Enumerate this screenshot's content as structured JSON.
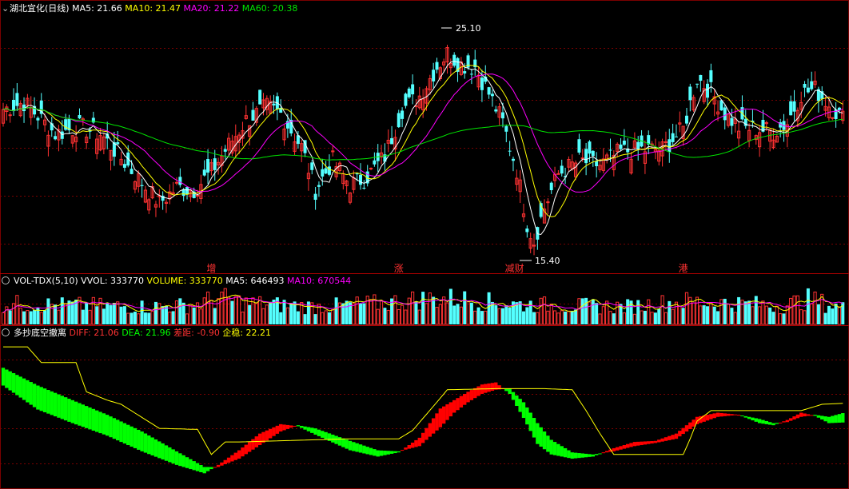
{
  "colors": {
    "background": "#000000",
    "up": "#ff3232",
    "down": "#54ffff",
    "ma5": "#ffffff",
    "ma10": "#ffff00",
    "ma20": "#ff00ff",
    "ma60": "#00e600",
    "grid": "#7a0000",
    "diff_green": "#00ff00",
    "diff_red": "#ff0000",
    "stabilize": "#ffff00"
  },
  "price_panel": {
    "icon": "chevron-down-icon",
    "title": "湖北宜化(日线)",
    "legend": [
      {
        "text": "MA5: 21.66",
        "color": "#ffffff"
      },
      {
        "text": "MA10: 21.47",
        "color": "#ffff00"
      },
      {
        "text": "MA20: 21.22",
        "color": "#ff00ff"
      },
      {
        "text": "MA60: 20.38",
        "color": "#00e600"
      }
    ],
    "high_label": "25.10",
    "low_label": "15.40",
    "markers": [
      {
        "text": "增",
        "index": 60
      },
      {
        "text": "涨",
        "index": 114
      },
      {
        "text": "减财",
        "index": 146
      },
      {
        "text": "港",
        "index": 196
      }
    ]
  },
  "volume_panel": {
    "icon": "chevron-down-icon",
    "legend": [
      {
        "text": "VOL-TDX(5,10)",
        "color": "#ffffff"
      },
      {
        "text": "VVOL: 333770",
        "color": "#ffffff"
      },
      {
        "text": "VOLUME: 333770",
        "color": "#ffff00"
      },
      {
        "text": "MA5: 646493",
        "color": "#ffffff"
      },
      {
        "text": "MA10: 670544",
        "color": "#ff00ff"
      }
    ]
  },
  "indicator_panel": {
    "icon": "chevron-down-icon",
    "legend": [
      {
        "text": "多抄底空撤离",
        "color": "#ffffff"
      },
      {
        "text": "DIFF: 21.06",
        "color": "#ff3232"
      },
      {
        "text": "DEA: 21.96",
        "color": "#00ff00"
      },
      {
        "text": "差距: -0.90",
        "color": "#ff3232"
      },
      {
        "text": "企稳: 22.21",
        "color": "#ffff00"
      }
    ]
  },
  "chart_data": {
    "type": "candlestick",
    "price_range": [
      15.0,
      26.0
    ],
    "series_names": [
      "MA5",
      "MA10",
      "MA20",
      "MA60"
    ],
    "price_keypoints": [
      [
        0,
        21.9
      ],
      [
        6,
        22.2
      ],
      [
        10,
        21.6
      ],
      [
        15,
        20.8
      ],
      [
        22,
        21.1
      ],
      [
        28,
        20.8
      ],
      [
        33,
        19.9
      ],
      [
        40,
        18.6
      ],
      [
        45,
        17.7
      ],
      [
        50,
        18.4
      ],
      [
        55,
        18.3
      ],
      [
        60,
        19.1
      ],
      [
        65,
        20.3
      ],
      [
        70,
        21.4
      ],
      [
        76,
        22.0
      ],
      [
        80,
        21.7
      ],
      [
        86,
        20.2
      ],
      [
        90,
        18.3
      ],
      [
        95,
        19.6
      ],
      [
        100,
        18.5
      ],
      [
        105,
        18.9
      ],
      [
        110,
        19.8
      ],
      [
        115,
        21.9
      ],
      [
        120,
        22.5
      ],
      [
        125,
        23.8
      ],
      [
        128,
        24.4
      ],
      [
        132,
        23.9
      ],
      [
        136,
        23.8
      ],
      [
        140,
        22.6
      ],
      [
        144,
        21.3
      ],
      [
        148,
        19.2
      ],
      [
        151,
        16.8
      ],
      [
        153,
        16.0
      ],
      [
        156,
        17.5
      ],
      [
        160,
        19.0
      ],
      [
        166,
        19.6
      ],
      [
        172,
        19.4
      ],
      [
        178,
        20.0
      ],
      [
        184,
        20.1
      ],
      [
        190,
        20.1
      ],
      [
        196,
        21.0
      ],
      [
        200,
        23.3
      ],
      [
        204,
        22.7
      ],
      [
        208,
        21.7
      ],
      [
        212,
        21.1
      ],
      [
        218,
        21.0
      ],
      [
        222,
        20.9
      ],
      [
        226,
        21.3
      ],
      [
        230,
        22.6
      ],
      [
        234,
        22.8
      ],
      [
        238,
        22.1
      ],
      [
        242,
        21.5
      ]
    ],
    "volume_range": [
      0,
      1300000
    ],
    "volume_keypoints": [
      [
        0,
        700000
      ],
      [
        20,
        650000
      ],
      [
        40,
        600000
      ],
      [
        55,
        650000
      ],
      [
        62,
        900000
      ],
      [
        70,
        720000
      ],
      [
        90,
        600000
      ],
      [
        110,
        720000
      ],
      [
        120,
        850000
      ],
      [
        130,
        880000
      ],
      [
        145,
        700000
      ],
      [
        160,
        640000
      ],
      [
        180,
        600000
      ],
      [
        196,
        780000
      ],
      [
        210,
        720000
      ],
      [
        225,
        640000
      ],
      [
        232,
        850000
      ],
      [
        242,
        560000
      ]
    ],
    "indicator_range": [
      15,
      29
    ],
    "diff_keypoints": [
      [
        0,
        24.6
      ],
      [
        10,
        22.3
      ],
      [
        20,
        21.0
      ],
      [
        30,
        19.8
      ],
      [
        40,
        18.3
      ],
      [
        50,
        17.0
      ],
      [
        58,
        16.2
      ],
      [
        62,
        17.0
      ],
      [
        68,
        18.4
      ],
      [
        74,
        20.0
      ],
      [
        80,
        20.9
      ],
      [
        85,
        20.7
      ],
      [
        90,
        19.9
      ],
      [
        100,
        18.4
      ],
      [
        108,
        17.8
      ],
      [
        114,
        18.2
      ],
      [
        120,
        19.6
      ],
      [
        126,
        22.4
      ],
      [
        130,
        23.2
      ],
      [
        134,
        24.0
      ],
      [
        138,
        24.7
      ],
      [
        142,
        24.9
      ],
      [
        146,
        23.8
      ],
      [
        150,
        21.5
      ],
      [
        154,
        19.0
      ],
      [
        158,
        18.0
      ],
      [
        164,
        17.6
      ],
      [
        170,
        17.8
      ],
      [
        176,
        18.6
      ],
      [
        182,
        19.2
      ],
      [
        188,
        19.3
      ],
      [
        194,
        20.0
      ],
      [
        200,
        21.6
      ],
      [
        206,
        22.0
      ],
      [
        212,
        21.8
      ],
      [
        218,
        21.0
      ],
      [
        222,
        20.8
      ],
      [
        226,
        21.3
      ],
      [
        230,
        22.0
      ],
      [
        234,
        21.7
      ],
      [
        238,
        21.0
      ],
      [
        242,
        21.06
      ]
    ],
    "dea_keypoints": [
      [
        0,
        26.3
      ],
      [
        10,
        24.6
      ],
      [
        20,
        23.2
      ],
      [
        30,
        21.8
      ],
      [
        40,
        20.2
      ],
      [
        50,
        18.3
      ],
      [
        58,
        16.8
      ],
      [
        62,
        16.8
      ],
      [
        68,
        17.6
      ],
      [
        74,
        18.9
      ],
      [
        80,
        20.2
      ],
      [
        85,
        20.8
      ],
      [
        90,
        20.5
      ],
      [
        100,
        19.3
      ],
      [
        108,
        18.4
      ],
      [
        114,
        18.3
      ],
      [
        120,
        18.8
      ],
      [
        126,
        20.6
      ],
      [
        130,
        22.0
      ],
      [
        134,
        23.0
      ],
      [
        138,
        23.8
      ],
      [
        142,
        24.2
      ],
      [
        146,
        24.3
      ],
      [
        150,
        23.0
      ],
      [
        154,
        21.0
      ],
      [
        158,
        19.4
      ],
      [
        164,
        18.2
      ],
      [
        170,
        18.0
      ],
      [
        176,
        18.3
      ],
      [
        182,
        18.8
      ],
      [
        188,
        19.1
      ],
      [
        194,
        19.5
      ],
      [
        200,
        20.9
      ],
      [
        206,
        21.6
      ],
      [
        212,
        21.8
      ],
      [
        218,
        21.4
      ],
      [
        222,
        21.0
      ],
      [
        226,
        21.1
      ],
      [
        230,
        21.6
      ],
      [
        234,
        21.8
      ],
      [
        238,
        21.6
      ],
      [
        242,
        21.96
      ]
    ],
    "stabilize_steps": [
      [
        0,
        28.3
      ],
      [
        7,
        28.3
      ],
      [
        11,
        26.8
      ],
      [
        21,
        26.8
      ],
      [
        24,
        24.0
      ],
      [
        30,
        23.2
      ],
      [
        34,
        22.8
      ],
      [
        45,
        20.5
      ],
      [
        56,
        20.4
      ],
      [
        60,
        18.0
      ],
      [
        64,
        19.2
      ],
      [
        68,
        19.2
      ],
      [
        100,
        19.5
      ],
      [
        114,
        19.5
      ],
      [
        118,
        20.3
      ],
      [
        126,
        23.4
      ],
      [
        128,
        24.2
      ],
      [
        142,
        24.3
      ],
      [
        156,
        24.3
      ],
      [
        164,
        24.2
      ],
      [
        168,
        22.2
      ],
      [
        172,
        20.0
      ],
      [
        176,
        18.0
      ],
      [
        190,
        18.0
      ],
      [
        196,
        18.0
      ],
      [
        198,
        19.5
      ],
      [
        200,
        21.2
      ],
      [
        204,
        22.2
      ],
      [
        230,
        22.2
      ],
      [
        236,
        22.8
      ],
      [
        242,
        22.9
      ]
    ]
  }
}
